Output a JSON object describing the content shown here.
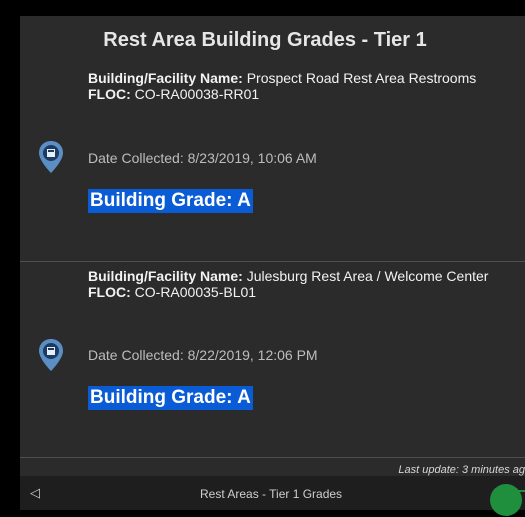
{
  "title": "Rest Area Building Grades - Tier 1",
  "cards": [
    {
      "name_label": "Building/Facility Name:",
      "name_value": "Prospect Road Rest Area Restrooms",
      "floc_label": "FLOC:",
      "floc_value": "CO-RA00038-RR01",
      "date_label": "Date Collected:",
      "date_value": "8/23/2019, 10:06 AM",
      "grade": "Building Grade: A"
    },
    {
      "name_label": "Building/Facility Name:",
      "name_value": "Julesburg Rest Area / Welcome Center",
      "floc_label": "FLOC:",
      "floc_value": "CO-RA00035-BL01",
      "date_label": "Date Collected:",
      "date_value": "8/22/2019, 12:06 PM",
      "grade": "Building Grade: A"
    }
  ],
  "footer": {
    "last_update": "Last update: 3 minutes ag",
    "bottom_title": "Rest Areas - Tier 1 Grades",
    "back_icon": "chevron-left-icon"
  },
  "colors": {
    "panel": "#2b2b2b",
    "grade_highlight": "#0a5bd6",
    "marker": "#5b8ec4",
    "status_dot": "#1f8f3d"
  }
}
